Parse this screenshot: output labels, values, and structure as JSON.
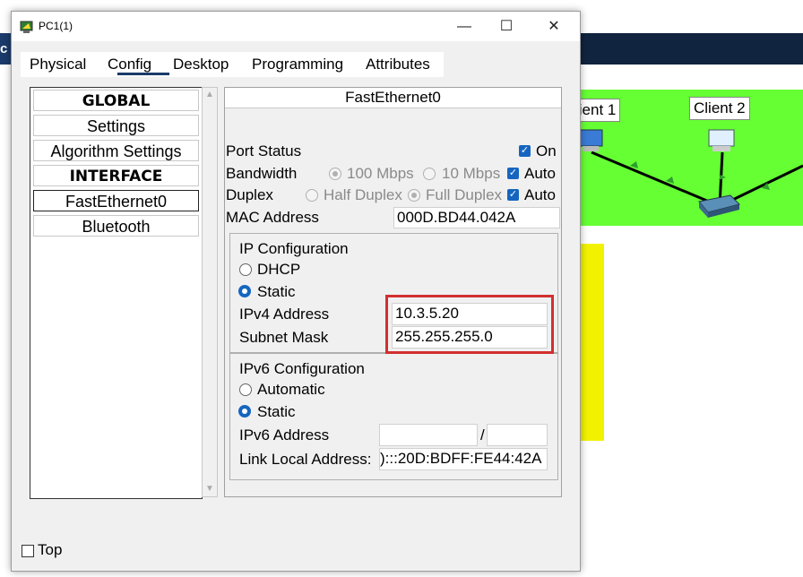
{
  "window": {
    "title": "PC1(1)",
    "controls": {
      "minimize": "—",
      "maximize": "☐",
      "close": "✕"
    }
  },
  "background": {
    "client1_label": "lient 1",
    "client2_label": "Client 2",
    "left_edge_text": "c",
    "colors": {
      "canvas_green": "#66ff33",
      "band_blue": "#10233f",
      "yellow": "#f2f200"
    }
  },
  "tabs": [
    {
      "label": "Physical"
    },
    {
      "label": "Config",
      "active": true
    },
    {
      "label": "Desktop"
    },
    {
      "label": "Programming"
    },
    {
      "label": "Attributes"
    }
  ],
  "sidebar": {
    "items": [
      {
        "label": "GLOBAL",
        "heading": true
      },
      {
        "label": "Settings"
      },
      {
        "label": "Algorithm Settings"
      },
      {
        "label": "INTERFACE",
        "heading": true
      },
      {
        "label": "FastEthernet0",
        "selected": true
      },
      {
        "label": "Bluetooth"
      }
    ]
  },
  "interface": {
    "header": "FastEthernet0",
    "port_status_label": "Port Status",
    "port_status_on_label": "On",
    "bandwidth_label": "Bandwidth",
    "bandwidth_100": "100 Mbps",
    "bandwidth_10": "10 Mbps",
    "bandwidth_auto": "Auto",
    "duplex_label": "Duplex",
    "duplex_half": "Half Duplex",
    "duplex_full": "Full Duplex",
    "duplex_auto": "Auto",
    "mac_label": "MAC Address",
    "mac_value": "000D.BD44.042A"
  },
  "ipv4": {
    "title": "IP Configuration",
    "dhcp_label": "DHCP",
    "static_label": "Static",
    "address_label": "IPv4 Address",
    "address_value": "10.3.5.20",
    "mask_label": "Subnet Mask",
    "mask_value": "255.255.255.0"
  },
  "ipv6": {
    "title": "IPv6 Configuration",
    "automatic_label": "Automatic",
    "static_label": "Static",
    "address_label": "IPv6 Address",
    "address_value": "",
    "prefix_separator": "/",
    "prefix_value": "",
    "link_local_label": "Link Local Address:",
    "link_local_value": "):::20D:BDFF:FE44:42A"
  },
  "footer": {
    "top_label": "Top"
  },
  "accent": {
    "selection_blue": "#1565c0",
    "highlight_red": "#d32f2f"
  }
}
